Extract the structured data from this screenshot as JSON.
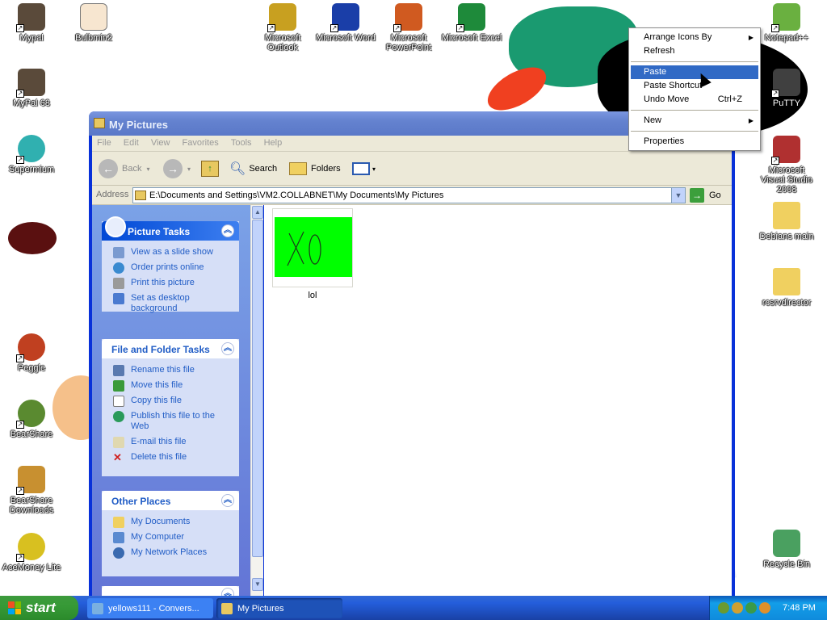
{
  "desktop": {
    "icons": [
      {
        "name": "mypal-icon",
        "label": "Mypal",
        "color": "#5a4a3a"
      },
      {
        "name": "bulbmin2-icon",
        "label": "Bulbmin2",
        "color": "#e8a060"
      },
      {
        "name": "mypal68-icon",
        "label": "MyPal 68",
        "color": "#5a4a3a"
      },
      {
        "name": "supermium-icon",
        "label": "Supermium",
        "color": "#30b0b0"
      },
      {
        "name": "outlook-icon",
        "label": "Microsoft Outlook",
        "color": "#c8a020"
      },
      {
        "name": "word-icon",
        "label": "Microsoft Word",
        "color": "#1a3ea8"
      },
      {
        "name": "powerpoint-icon",
        "label": "Microsoft PowerPoint",
        "color": "#d05a20"
      },
      {
        "name": "excel-icon",
        "label": "Microsoft Excel",
        "color": "#1e8a3a"
      },
      {
        "name": "notepadpp-icon",
        "label": "Notepad++",
        "color": "#6ab040"
      },
      {
        "name": "putty-icon",
        "label": "PuTTY",
        "color": "#404040"
      },
      {
        "name": "visual-studio-icon",
        "label": "Microsoft Visual Studio 2008",
        "color": "#b03030"
      },
      {
        "name": "folder-icon",
        "label": "Debians main",
        "color": "#f0d060"
      },
      {
        "name": "folder-icon",
        "label": "rcsrvdirector",
        "color": "#f0d060"
      },
      {
        "name": "peggle-icon",
        "label": "Peggle",
        "color": "#c04020"
      },
      {
        "name": "bearshare-icon",
        "label": "BearShare",
        "color": "#5a8a30"
      },
      {
        "name": "bearshare-downloads-icon",
        "label": "BearShare Downloads",
        "color": "#c89030"
      },
      {
        "name": "acemoney-icon",
        "label": "AceMoney Lite",
        "color": "#d8c020"
      },
      {
        "name": "recycle-bin-icon",
        "label": "Recycle Bin",
        "color": "#4aa060"
      }
    ]
  },
  "window": {
    "title": "My Pictures",
    "menu": [
      "File",
      "Edit",
      "View",
      "Favorites",
      "Tools",
      "Help"
    ],
    "toolbar": {
      "back": "Back",
      "search": "Search",
      "folders": "Folders"
    },
    "address": {
      "label": "Address",
      "value": "E:\\Documents and Settings\\VM2.COLLABNET\\My Documents\\My Pictures",
      "go": "Go"
    },
    "panels": {
      "picture_tasks": {
        "title": "Picture Tasks",
        "items": [
          "View as a slide show",
          "Order prints online",
          "Print this picture",
          "Set as desktop background"
        ]
      },
      "file_folder_tasks": {
        "title": "File and Folder Tasks",
        "items": [
          "Rename this file",
          "Move this file",
          "Copy this file",
          "Publish this file to the Web",
          "E-mail this file",
          "Delete this file"
        ]
      },
      "other_places": {
        "title": "Other Places",
        "items": [
          "My Documents",
          "My Computer",
          "My Network Places"
        ]
      }
    },
    "files": [
      {
        "name": "lol",
        "thumb_color": "#00ff00"
      }
    ]
  },
  "context_menu": {
    "items": [
      {
        "label": "Arrange Icons By",
        "submenu": true
      },
      {
        "label": "Refresh"
      },
      {
        "label": "Paste",
        "highlighted": true
      },
      {
        "label": "Paste Shortcut"
      },
      {
        "label": "Undo Move",
        "shortcut": "Ctrl+Z"
      },
      {
        "label": "New",
        "submenu": true
      },
      {
        "label": "Properties"
      }
    ]
  },
  "taskbar": {
    "start": "start",
    "buttons": [
      {
        "label": "yellows111 - Convers..."
      },
      {
        "label": "My Pictures"
      }
    ],
    "clock": "7:48 PM"
  },
  "colors": {
    "xp_blue": "#0831d9",
    "task_pane": "#6375d6",
    "highlight": "#316ac5",
    "start_green": "#3c9a3c"
  }
}
